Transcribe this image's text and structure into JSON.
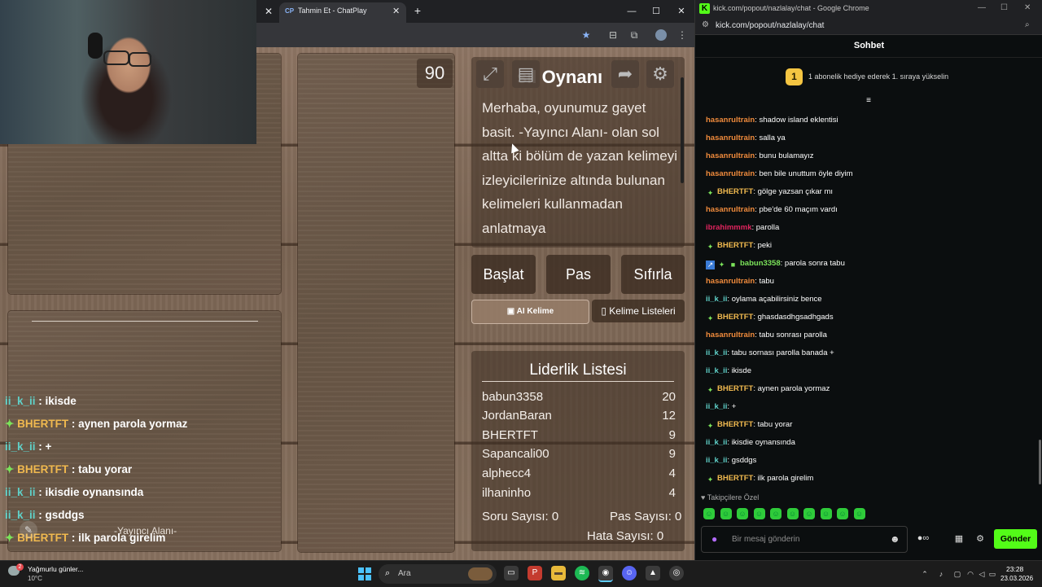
{
  "game_window": {
    "tab_title": "Tahmin Et - ChatPlay",
    "tab_favicon": "CP",
    "controls": {
      "minimize": "—",
      "maximize": "☐",
      "close": "✕"
    }
  },
  "game": {
    "timer": "90",
    "rules_title": "Nasıl Oynanır",
    "rules_title_visible": "sıl Oynanı",
    "rules_text": "Merhaba, oyunumuz gayet basit. -Yayıncı Alanı- olan sol altta ki bölüm de yazan kelimeyi izleyicilerinize altında bulunan kelimeleri kullanmadan anlatmaya",
    "buttons": {
      "start": "Başlat",
      "pass": "Pas",
      "reset": "Sıfırla",
      "ai_word": "AI Kelime",
      "word_lists": "Kelime Listeleri"
    },
    "leaderboard": {
      "title": "Liderlik Listesi",
      "rows": [
        {
          "name": "babun3358",
          "score": "20"
        },
        {
          "name": "JordanBaran",
          "score": "12"
        },
        {
          "name": "BHERTFT",
          "score": "9"
        },
        {
          "name": "Sapancali00",
          "score": "9"
        },
        {
          "name": "alphecc4",
          "score": "4"
        },
        {
          "name": "ilhaninho",
          "score": "4"
        }
      ],
      "question_count": "Soru Sayısı: 0",
      "pass_count": "Pas Sayısı: 0",
      "error_count": "Hata Sayısı: 0"
    },
    "streamer_area_label": "-Yayıncı Alanı-",
    "chat_overlay": [
      {
        "user": "ii_k_ii",
        "text": " : ikisde",
        "color": "#5fd1c9",
        "badge": ""
      },
      {
        "user": "BHERTFT",
        "text": " : aynen parola yormaz",
        "color": "#f0b94f",
        "badge": "✦"
      },
      {
        "user": "ii_k_ii",
        "text": " : +",
        "color": "#5fd1c9",
        "badge": ""
      },
      {
        "user": "BHERTFT",
        "text": " : tabu yorar",
        "color": "#f0b94f",
        "badge": "✦"
      },
      {
        "user": "ii_k_ii",
        "text": " : ikisdie oynansında",
        "color": "#5fd1c9",
        "badge": ""
      },
      {
        "user": "ii_k_ii",
        "text": " : gsddgs",
        "color": "#5fd1c9",
        "badge": ""
      },
      {
        "user": "BHERTFT",
        "text": " : ilk parola girelim",
        "color": "#f0b94f",
        "badge": "✦"
      }
    ]
  },
  "chat_window": {
    "title": "kick.com/popout/nazlalay/chat - Google Chrome",
    "url": "kick.com/popout/nazlalay/chat",
    "header": "Sohbet",
    "gift_banner": {
      "rank": "1",
      "text": "1 abonelik hediye ederek 1. sıraya yükselin"
    },
    "messages": [
      {
        "user": "hasanrultrain",
        "text": ": shadow island eklentisi",
        "color": "#f08b3c",
        "badges": ""
      },
      {
        "user": "hasanrultrain",
        "text": ": salla ya",
        "color": "#f08b3c",
        "badges": ""
      },
      {
        "user": "hasanrultrain",
        "text": ": bunu bulamayız",
        "color": "#f08b3c",
        "badges": ""
      },
      {
        "user": "hasanrultrain",
        "text": ": ben bile unuttum öyle diyim",
        "color": "#f08b3c",
        "badges": ""
      },
      {
        "user": "BHERTFT",
        "text": ": gölge yazsan çıkar mı",
        "color": "#f0b94f",
        "badges": "✦"
      },
      {
        "user": "hasanrultrain",
        "text": ": pbe'de 60 maçım vardı",
        "color": "#f08b3c",
        "badges": ""
      },
      {
        "user": "ibrahimmmk",
        "text": ": parolla",
        "color": "#e0245e",
        "badges": ""
      },
      {
        "user": "BHERTFT",
        "text": ": peki",
        "color": "#f0b94f",
        "badges": "✦"
      },
      {
        "user": "babun3358",
        "text": ": parola sonra tabu",
        "color": "#7be35a",
        "badges": "↗✦■"
      },
      {
        "user": "hasanrultrain",
        "text": ": tabu",
        "color": "#f08b3c",
        "badges": ""
      },
      {
        "user": "ii_k_ii",
        "text": ": oylama açabilirsiniz bence",
        "color": "#5fd1c9",
        "badges": ""
      },
      {
        "user": "BHERTFT",
        "text": ": ghasdasdhgsadhgads",
        "color": "#f0b94f",
        "badges": "✦"
      },
      {
        "user": "hasanrultrain",
        "text": ": tabu sonrası parolla",
        "color": "#f08b3c",
        "badges": ""
      },
      {
        "user": "ii_k_ii",
        "text": ": tabu sornası parolla banada +",
        "color": "#5fd1c9",
        "badges": ""
      },
      {
        "user": "ii_k_ii",
        "text": ": ikisde",
        "color": "#5fd1c9",
        "badges": ""
      },
      {
        "user": "BHERTFT",
        "text": ": aynen parola yormaz",
        "color": "#f0b94f",
        "badges": "✦"
      },
      {
        "user": "ii_k_ii",
        "text": ": +",
        "color": "#5fd1c9",
        "badges": ""
      },
      {
        "user": "BHERTFT",
        "text": ": tabu yorar",
        "color": "#f0b94f",
        "badges": "✦"
      },
      {
        "user": "ii_k_ii",
        "text": ": ikisdie oynansında",
        "color": "#5fd1c9",
        "badges": ""
      },
      {
        "user": "ii_k_ii",
        "text": ": gsddgs",
        "color": "#5fd1c9",
        "badges": ""
      },
      {
        "user": "BHERTFT",
        "text": ": ilk parola girelim",
        "color": "#f0b94f",
        "badges": "✦"
      }
    ],
    "followers_only_label": "Takipçilere Özel",
    "input_placeholder": "Bir mesaj gönderin",
    "send_label": "Gönder"
  },
  "taskbar": {
    "weather_title": "Yağmurlu günler...",
    "weather_temp": "10°C",
    "weather_badge": "2",
    "search_placeholder": "Ara",
    "time": "23:28",
    "date": "23.03.2026"
  },
  "colors": {
    "kick_green": "#53fc18",
    "chrome_dark": "#202124",
    "wood": "#7a6453"
  }
}
